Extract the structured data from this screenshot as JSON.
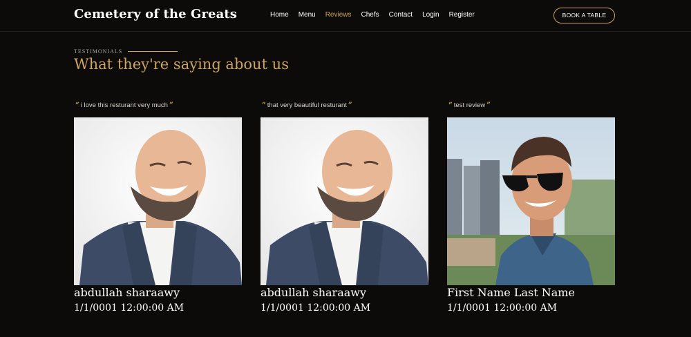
{
  "header": {
    "logo": "Cemetery of the Greats",
    "nav": [
      "Home",
      "Menu",
      "Reviews",
      "Chefs",
      "Contact",
      "Login",
      "Register"
    ],
    "active_nav": "Reviews",
    "book_button": "BOOK A TABLE"
  },
  "section": {
    "kicker": "TESTIMONIALS",
    "title": "What they're saying about us"
  },
  "testimonials": [
    {
      "quote": "i love this resturant very much",
      "name": "abdullah sharaawy",
      "date": "1/1/0001 12:00:00 AM"
    },
    {
      "quote": "that very beautiful resturant",
      "name": "abdullah sharaawy",
      "date": "1/1/0001 12:00:00 AM"
    },
    {
      "quote": "test review",
      "name": "First Name Last Name",
      "date": "1/1/0001 12:00:00 AM"
    }
  ],
  "colors": {
    "background": "#0c0b09",
    "accent": "#cda45e",
    "text": "#ffffff"
  }
}
